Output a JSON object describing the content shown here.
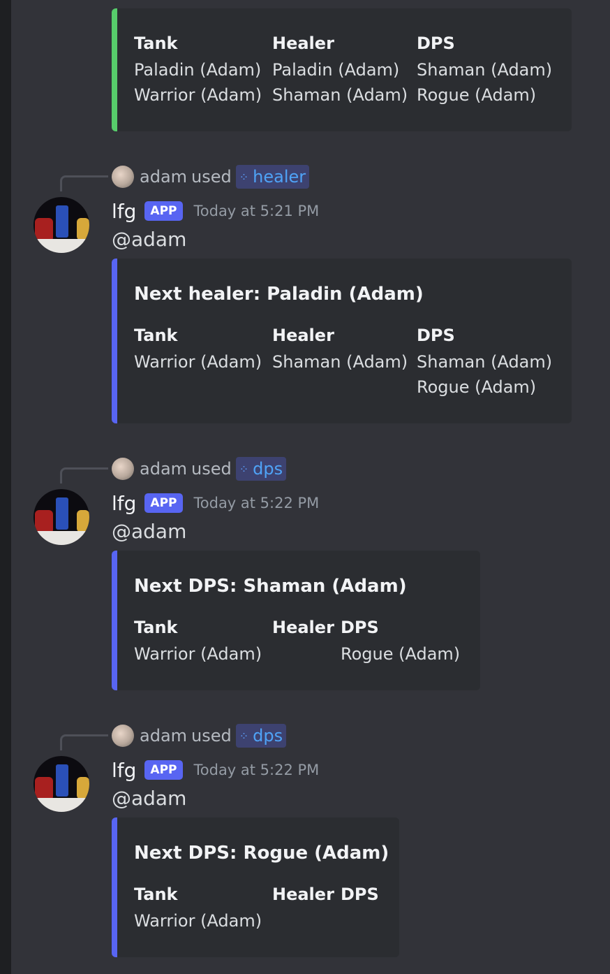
{
  "accent_colors": {
    "blurple": "#5865f2",
    "green": "#57cc6b",
    "link": "#4fa3f7"
  },
  "messages": [
    {
      "embed": {
        "title": "",
        "fields": [
          {
            "name": "Tank",
            "values": [
              "Paladin (Adam)",
              "Warrior (Adam)"
            ]
          },
          {
            "name": "Healer",
            "values": [
              "Paladin (Adam)",
              "Shaman (Adam)"
            ]
          },
          {
            "name": "DPS",
            "values": [
              "Shaman (Adam)",
              "Rogue (Adam)"
            ]
          }
        ]
      }
    },
    {
      "interaction": {
        "user": "adam",
        "verb": "used",
        "command": "healer",
        "icon": "slash-command-icon"
      },
      "author": "lfg",
      "tag": "APP",
      "timestamp": "Today at 5:21 PM",
      "content": "@adam",
      "embed": {
        "title": "Next healer: Paladin (Adam)",
        "fields": [
          {
            "name": "Tank",
            "values": [
              "Warrior (Adam)"
            ]
          },
          {
            "name": "Healer",
            "values": [
              "Shaman (Adam)"
            ]
          },
          {
            "name": "DPS",
            "values": [
              "Shaman (Adam)",
              "Rogue (Adam)"
            ]
          }
        ]
      }
    },
    {
      "interaction": {
        "user": "adam",
        "verb": "used",
        "command": "dps",
        "icon": "slash-command-icon"
      },
      "author": "lfg",
      "tag": "APP",
      "timestamp": "Today at 5:22 PM",
      "content": "@adam",
      "embed": {
        "title": "Next DPS: Shaman (Adam)",
        "fields": [
          {
            "name": "Tank",
            "values": [
              "Warrior (Adam)"
            ]
          },
          {
            "name": "Healer",
            "values": []
          },
          {
            "name": "DPS",
            "values": [
              "Rogue (Adam)"
            ]
          }
        ]
      }
    },
    {
      "interaction": {
        "user": "adam",
        "verb": "used",
        "command": "dps",
        "icon": "slash-command-icon"
      },
      "author": "lfg",
      "tag": "APP",
      "timestamp": "Today at 5:22 PM",
      "content": "@adam",
      "embed": {
        "title": "Next DPS: Rogue (Adam)",
        "fields": [
          {
            "name": "Tank",
            "values": [
              "Warrior (Adam)"
            ]
          },
          {
            "name": "Healer",
            "values": []
          },
          {
            "name": "DPS",
            "values": []
          }
        ]
      }
    }
  ]
}
